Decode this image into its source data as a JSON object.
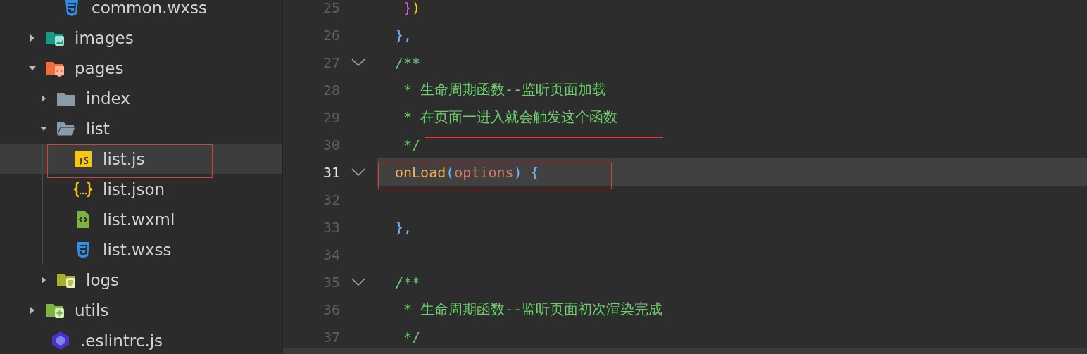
{
  "file_tree": [
    {
      "children": [
        {
          "label": "common.wxss",
          "kind": "css",
          "selected": false
        }
      ]
    },
    {
      "label": "images",
      "kind": "folder-images",
      "expanded": false,
      "selected": false
    },
    {
      "label": "pages",
      "kind": "folder-pages",
      "expanded": true,
      "selected": false,
      "children": [
        {
          "label": "index",
          "kind": "folder",
          "expanded": false,
          "selected": false
        },
        {
          "label": "list",
          "kind": "folder",
          "expanded": true,
          "selected": false,
          "children": [
            {
              "label": "list.js",
              "kind": "js",
              "selected": true
            },
            {
              "label": "list.json",
              "kind": "json",
              "selected": false
            },
            {
              "label": "list.wxml",
              "kind": "wxml",
              "selected": false
            },
            {
              "label": "list.wxss",
              "kind": "css",
              "selected": false
            }
          ]
        },
        {
          "label": "logs",
          "kind": "folder-logs",
          "expanded": false,
          "selected": false
        }
      ]
    },
    {
      "label": "utils",
      "kind": "folder-utils",
      "expanded": false,
      "selected": false
    },
    {
      "label": ".eslintrc.js",
      "kind": "eslint",
      "selected": false
    }
  ],
  "editor": {
    "lines": [
      {
        "number": "25",
        "fold": false,
        "current": false,
        "tokens": [
          {
            "text": " }",
            "kind": "brace-pink"
          },
          {
            "text": ")",
            "kind": "paren-yellow"
          }
        ]
      },
      {
        "number": "26",
        "fold": false,
        "current": false,
        "tokens": [
          {
            "text": "},",
            "kind": "punct"
          }
        ]
      },
      {
        "number": "27",
        "fold": true,
        "current": false,
        "tokens": [
          {
            "text": "/**",
            "kind": "comment"
          }
        ]
      },
      {
        "number": "28",
        "fold": false,
        "current": false,
        "tokens": [
          {
            "text": " * 生命周期函数--监听页面加载",
            "kind": "comment"
          }
        ]
      },
      {
        "number": "29",
        "fold": false,
        "current": false,
        "tokens": [
          {
            "text": " * 在页面一进入就会触发这个函数",
            "kind": "comment"
          }
        ]
      },
      {
        "number": "30",
        "fold": false,
        "current": false,
        "tokens": [
          {
            "text": " */",
            "kind": "comment"
          }
        ]
      },
      {
        "number": "31",
        "fold": true,
        "current": true,
        "tokens": [
          {
            "text": "onLoad",
            "kind": "function"
          },
          {
            "text": "(",
            "kind": "punct"
          },
          {
            "text": "options",
            "kind": "param"
          },
          {
            "text": ") ",
            "kind": "punct"
          },
          {
            "text": "{",
            "kind": "punct"
          }
        ]
      },
      {
        "number": "32",
        "fold": false,
        "current": false
      },
      {
        "number": "33",
        "fold": false,
        "current": false,
        "tokens": [
          {
            "text": "},",
            "kind": "punct"
          }
        ]
      },
      {
        "number": "34",
        "fold": false,
        "current": false
      },
      {
        "number": "35",
        "fold": true,
        "current": false,
        "tokens": [
          {
            "text": "/**",
            "kind": "comment"
          }
        ]
      },
      {
        "number": "36",
        "fold": false,
        "current": false,
        "tokens": [
          {
            "text": " * 生命周期函数--监听页面初次渲染完成",
            "kind": "comment"
          }
        ]
      },
      {
        "number": "37",
        "fold": false,
        "current": false,
        "tokens": [
          {
            "text": " */",
            "kind": "comment"
          }
        ]
      }
    ]
  }
}
